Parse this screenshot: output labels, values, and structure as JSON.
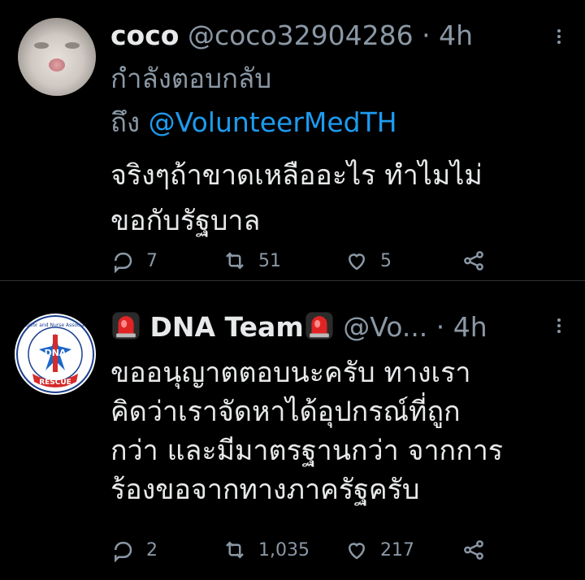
{
  "tweet1": {
    "name": "coco",
    "handle": "@coco32904286",
    "separator": "·",
    "time": "4h",
    "replying_label": "กำลังตอบกลับ",
    "to_label": "ถึง",
    "mention": "@VolunteerMedTH",
    "body_line1": "จริงๆถ้าขาดเหลืออะไร ทำไมไม่",
    "body_line2": "ขอกับรัฐบาล",
    "reply_count": "7",
    "retweet_count": "51",
    "like_count": "5"
  },
  "tweet2": {
    "name": "DNA Team",
    "handle": "@Vo...",
    "separator": "·",
    "time": "4h",
    "avatar_ring_text": "Doctor and Nurse Associate",
    "avatar_center_text": "DNA",
    "avatar_banner_text": "RESCUE",
    "body_lines": [
      "ขออนุญาตตอบนะครับ ทางเรา",
      "คิดว่าเราจัดหาได้อุปกรณ์ที่ถูก",
      "กว่า และมีมาตรฐานกว่า จากการ",
      "ร้องขอจากทางภาครัฐครับ"
    ],
    "reply_count": "2",
    "retweet_count": "1,035",
    "like_count": "217"
  },
  "icons": {
    "reply": "reply-icon",
    "retweet": "retweet-icon",
    "like": "heart-icon",
    "share": "share-icon",
    "more": "more-icon",
    "emoji": "police-light-icon"
  },
  "colors": {
    "background": "#000000",
    "text": "#e7e9ea",
    "muted": "#8b98a5",
    "link": "#1d9bf0",
    "divider": "#2f3336"
  }
}
